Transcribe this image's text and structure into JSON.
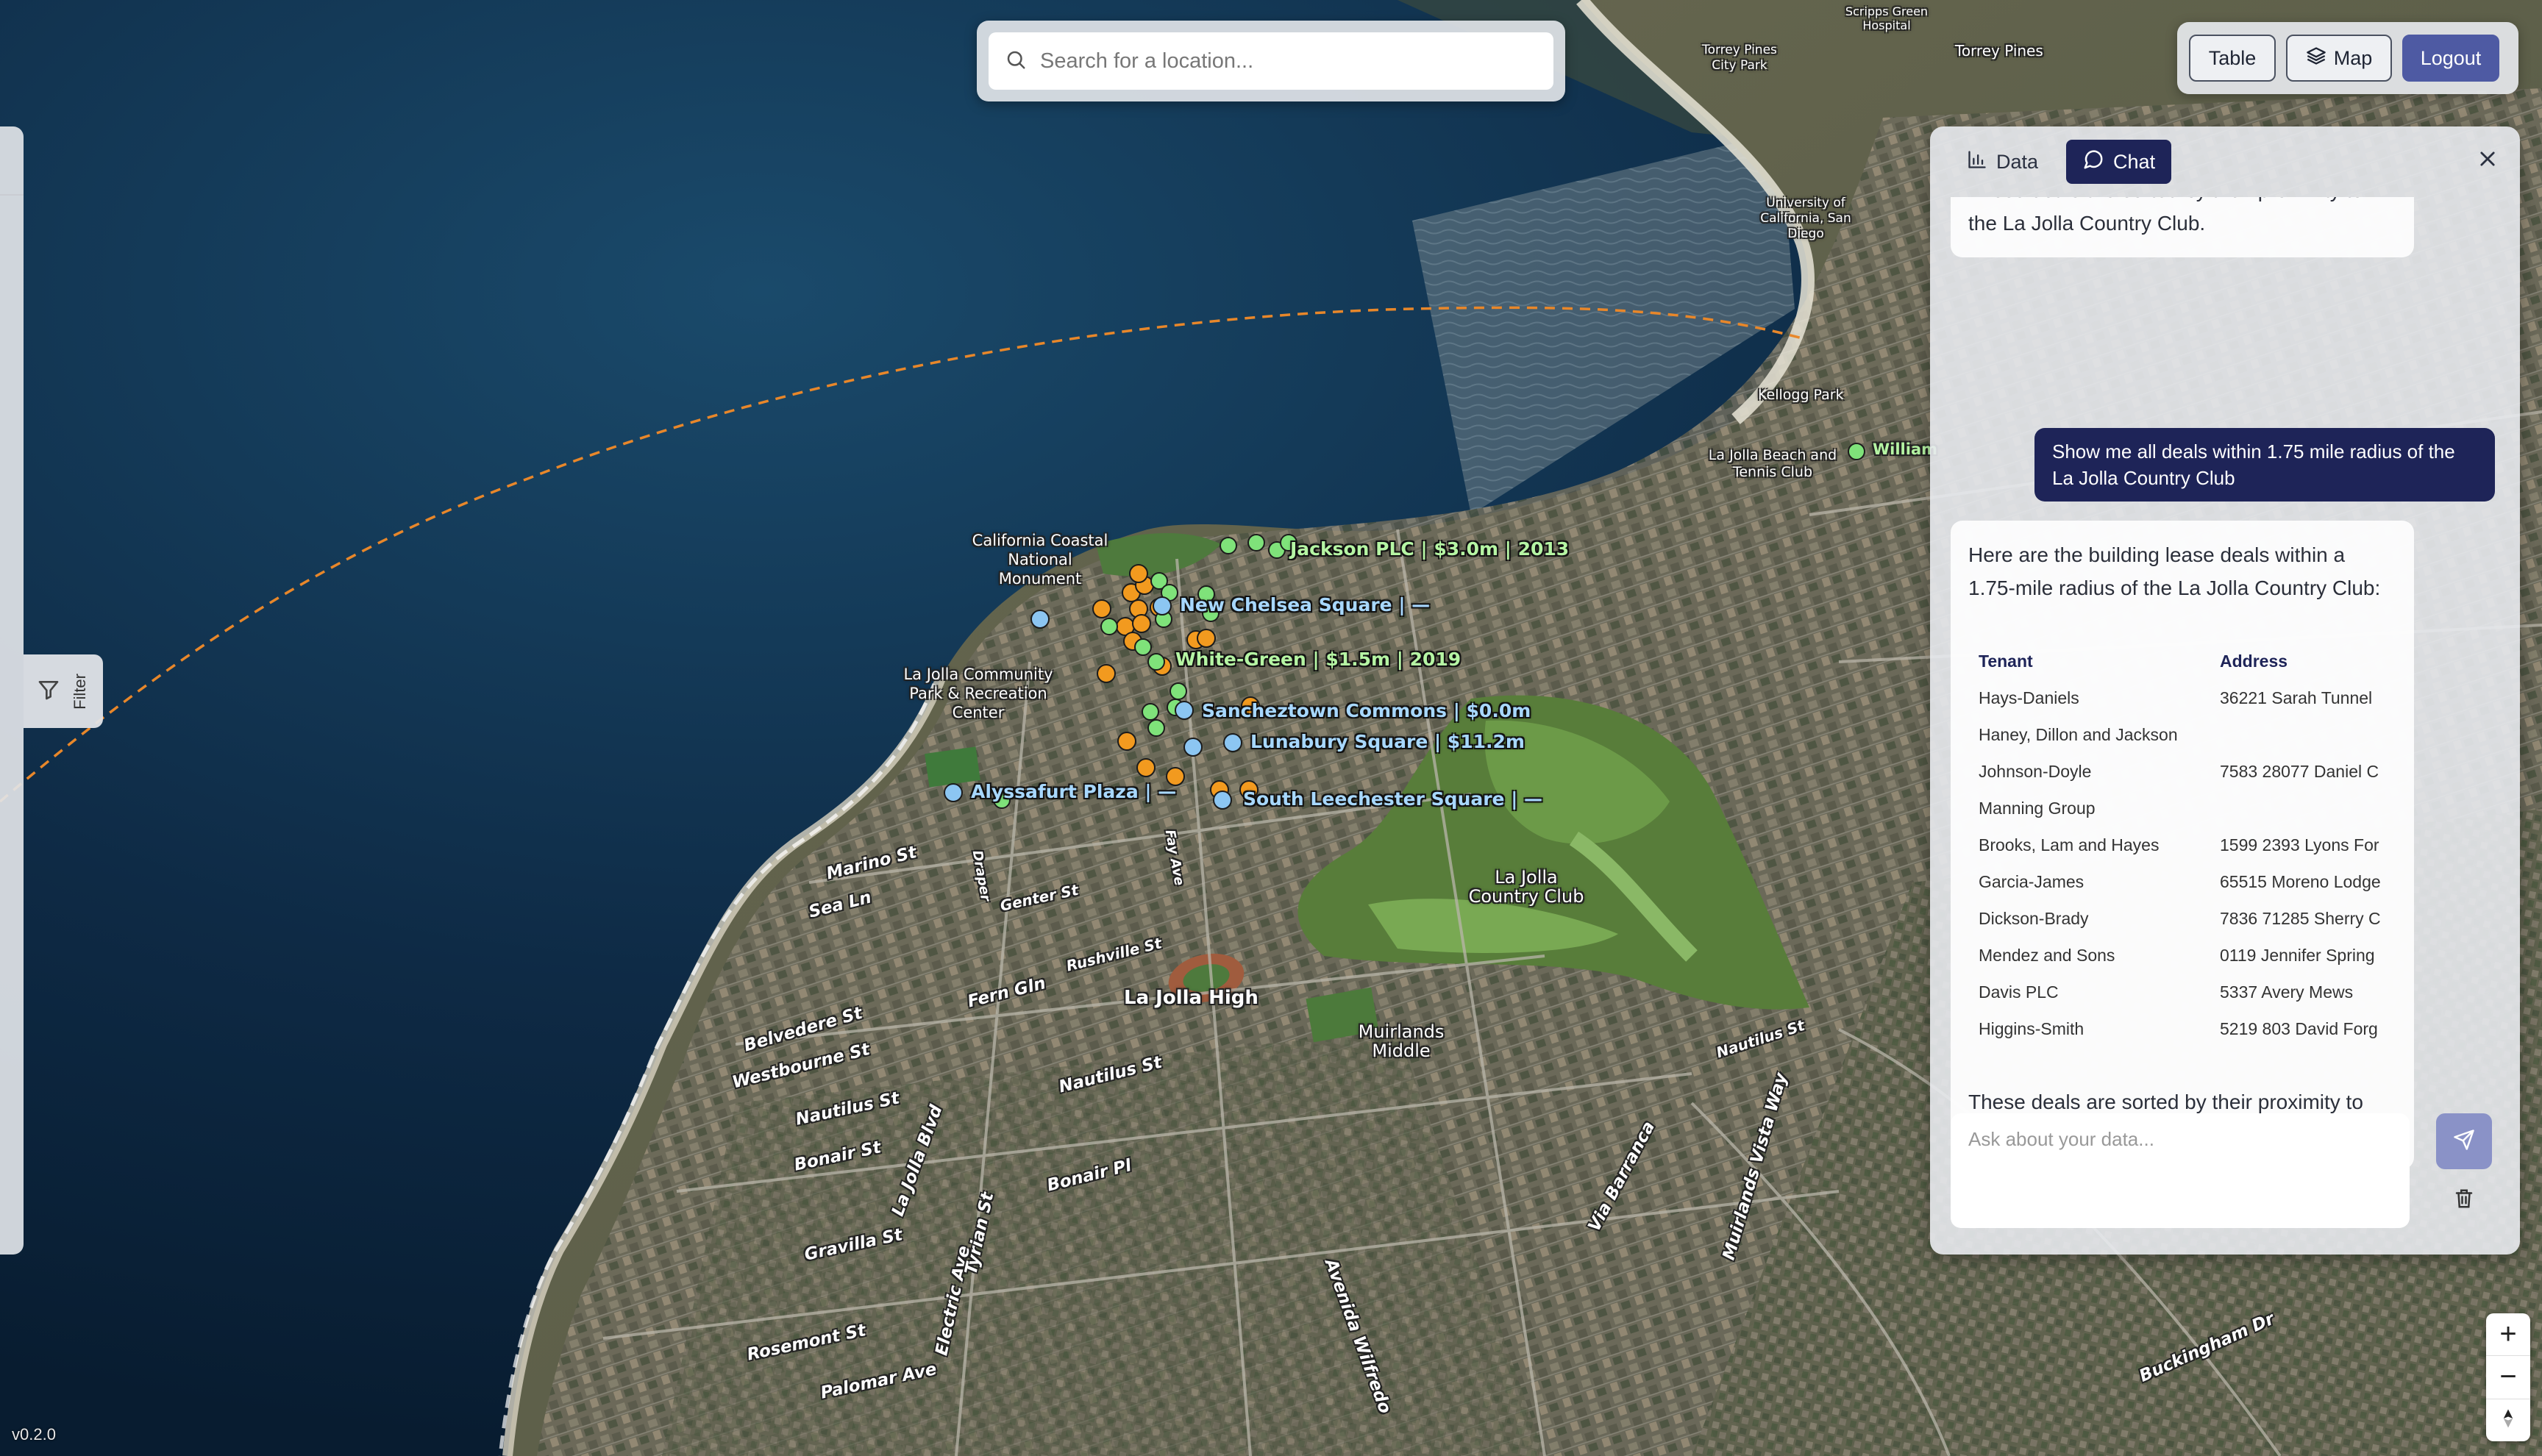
{
  "search": {
    "placeholder": "Search for a location..."
  },
  "topbar": {
    "table_label": "Table",
    "map_label": "Map",
    "logout_label": "Logout"
  },
  "filter": {
    "label": "Filter"
  },
  "panel": {
    "tabs": [
      {
        "label": "Data"
      },
      {
        "label": "Chat"
      }
    ],
    "active_tab": "Chat",
    "messages": {
      "prev_ai_text": "These deals are sorted by their proximity to the La Jolla Country Club.",
      "user_text": "Show me all deals within 1.75 mile radius of the La Jolla Country Club",
      "ai_intro": "Here are the building lease deals within a 1.75-mile radius of the La Jolla Country Club:",
      "table_headers": {
        "tenant": "Tenant",
        "address": "Address"
      },
      "rows": [
        {
          "tenant": "Hays-Daniels",
          "address": "36221 Sarah Tunnel"
        },
        {
          "tenant": "Haney, Dillon and Jackson",
          "address": ""
        },
        {
          "tenant": "Johnson-Doyle",
          "address": "7583 28077 Daniel C"
        },
        {
          "tenant": "Manning Group",
          "address": ""
        },
        {
          "tenant": "Brooks, Lam and Hayes",
          "address": "1599 2393 Lyons For"
        },
        {
          "tenant": "Garcia-James",
          "address": "65515 Moreno Lodge"
        },
        {
          "tenant": "Dickson-Brady",
          "address": "7836 71285 Sherry C"
        },
        {
          "tenant": "Mendez and Sons",
          "address": "0119 Jennifer Spring"
        },
        {
          "tenant": "Davis PLC",
          "address": "5337 Avery Mews"
        },
        {
          "tenant": "Higgins-Smith",
          "address": "5219 803 David Forg"
        }
      ],
      "ai_outro": "These deals are sorted by their proximity to the La Jolla Country Club."
    },
    "composer_placeholder": "Ask about your data..."
  },
  "map": {
    "place_labels": {
      "coastal_monument": "California Coastal National Monument",
      "rec_center": "La Jolla Community Park & Recreation Center",
      "country_club": "La Jolla Country Club",
      "la_jolla_high": "La Jolla High",
      "muirlands": "Muirlands Middle",
      "kellogg": "Kellogg Park",
      "beach_tennis": "La Jolla Beach and Tennis Club",
      "ucsd": "University of California, San Diego",
      "torrey_city_park": "Torrey Pines City Park",
      "torrey_pines": "Torrey Pines",
      "scripps": "Scripps Green Hospital",
      "william": "William"
    },
    "streets": [
      "Marino St",
      "Sea Ln",
      "Fern Gln",
      "Belvedere St",
      "Westbourne St",
      "Nautilus St",
      "Bonair St",
      "Gravilla St",
      "Rosemont St",
      "Palomar Ave",
      "Electric Ave",
      "Tyrian St",
      "La Jolla Blvd",
      "Bonair Pl",
      "Nautilus St",
      "Avenida Wilfredo",
      "Via Barranca",
      "Muirlands Vista Way",
      "Buckingham Dr",
      "Genter St",
      "Rushville St",
      "Draper",
      "Fay Ave",
      "Nautilus St"
    ],
    "deals": [
      {
        "label": "Jackson PLC | $3.0m | 2013",
        "color": "green"
      },
      {
        "label": "New Chelsea Square | —",
        "color": "blue"
      },
      {
        "label": "White-Green | $1.5m | 2019",
        "color": "green"
      },
      {
        "label": "Sancheztown Commons | $0.0m",
        "color": "blue"
      },
      {
        "label": "Lunabury Square | $11.2m",
        "color": "blue"
      },
      {
        "label": "Alyssafurt Plaza | —",
        "color": "blue"
      },
      {
        "label": "South Leechester Square | —",
        "color": "blue"
      }
    ],
    "colors": {
      "ocean": "#0e2a45",
      "marker_orange": "#f29a1f",
      "marker_green": "#7fe27a",
      "marker_blue": "#8cc6f2",
      "accent_navy": "#1e2458"
    }
  },
  "zoom": {
    "in": "+",
    "out": "−"
  },
  "version": "v0.2.0"
}
